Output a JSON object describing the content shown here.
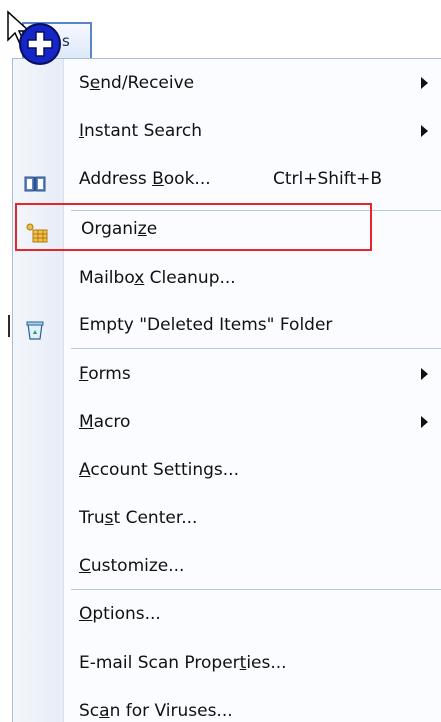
{
  "menu_tab": {
    "label_visible": "s"
  },
  "menu": {
    "items": [
      {
        "pre": "S",
        "u": "e",
        "post": "nd/Receive",
        "shortcut": "",
        "submenu": true,
        "icon": ""
      },
      {
        "pre": "",
        "u": "I",
        "post": "nstant Search",
        "shortcut": "",
        "submenu": true,
        "icon": ""
      },
      {
        "pre": "Address ",
        "u": "B",
        "post": "ook...",
        "shortcut": "Ctrl+Shift+B",
        "submenu": false,
        "icon": "address-book-icon"
      },
      {
        "pre": "Organi",
        "u": "z",
        "post": "e",
        "shortcut": "",
        "submenu": false,
        "icon": "organize-icon",
        "highlighted": true
      },
      {
        "pre": "Mailbo",
        "u": "x",
        "post": " Cleanup...",
        "shortcut": "",
        "submenu": false,
        "icon": ""
      },
      {
        "pre": "Empty \"Deleted Items\" Folder",
        "u": "",
        "post": "",
        "shortcut": "",
        "submenu": false,
        "icon": "recycle-bin-icon"
      },
      {
        "pre": "",
        "u": "F",
        "post": "orms",
        "shortcut": "",
        "submenu": true,
        "icon": ""
      },
      {
        "pre": "",
        "u": "M",
        "post": "acro",
        "shortcut": "",
        "submenu": true,
        "icon": ""
      },
      {
        "pre": "",
        "u": "A",
        "post": "ccount Settings...",
        "shortcut": "",
        "submenu": false,
        "icon": ""
      },
      {
        "pre": "Tru",
        "u": "s",
        "post": "t Center...",
        "shortcut": "",
        "submenu": false,
        "icon": ""
      },
      {
        "pre": "",
        "u": "C",
        "post": "ustomize...",
        "shortcut": "",
        "submenu": false,
        "icon": ""
      },
      {
        "pre": "",
        "u": "O",
        "post": "ptions...",
        "shortcut": "",
        "submenu": false,
        "icon": ""
      },
      {
        "pre": "E-mail Scan Proper",
        "u": "t",
        "post": "ies...",
        "shortcut": "",
        "submenu": false,
        "icon": ""
      },
      {
        "pre": "Sc",
        "u": "a",
        "post": "n for Viruses...",
        "shortcut": "",
        "submenu": false,
        "icon": ""
      }
    ]
  },
  "colors": {
    "highlight_border": "#e6262d",
    "tab_border": "#5a85c8",
    "separator": "#b8c8df",
    "cursor_badge": "#1426c8"
  }
}
